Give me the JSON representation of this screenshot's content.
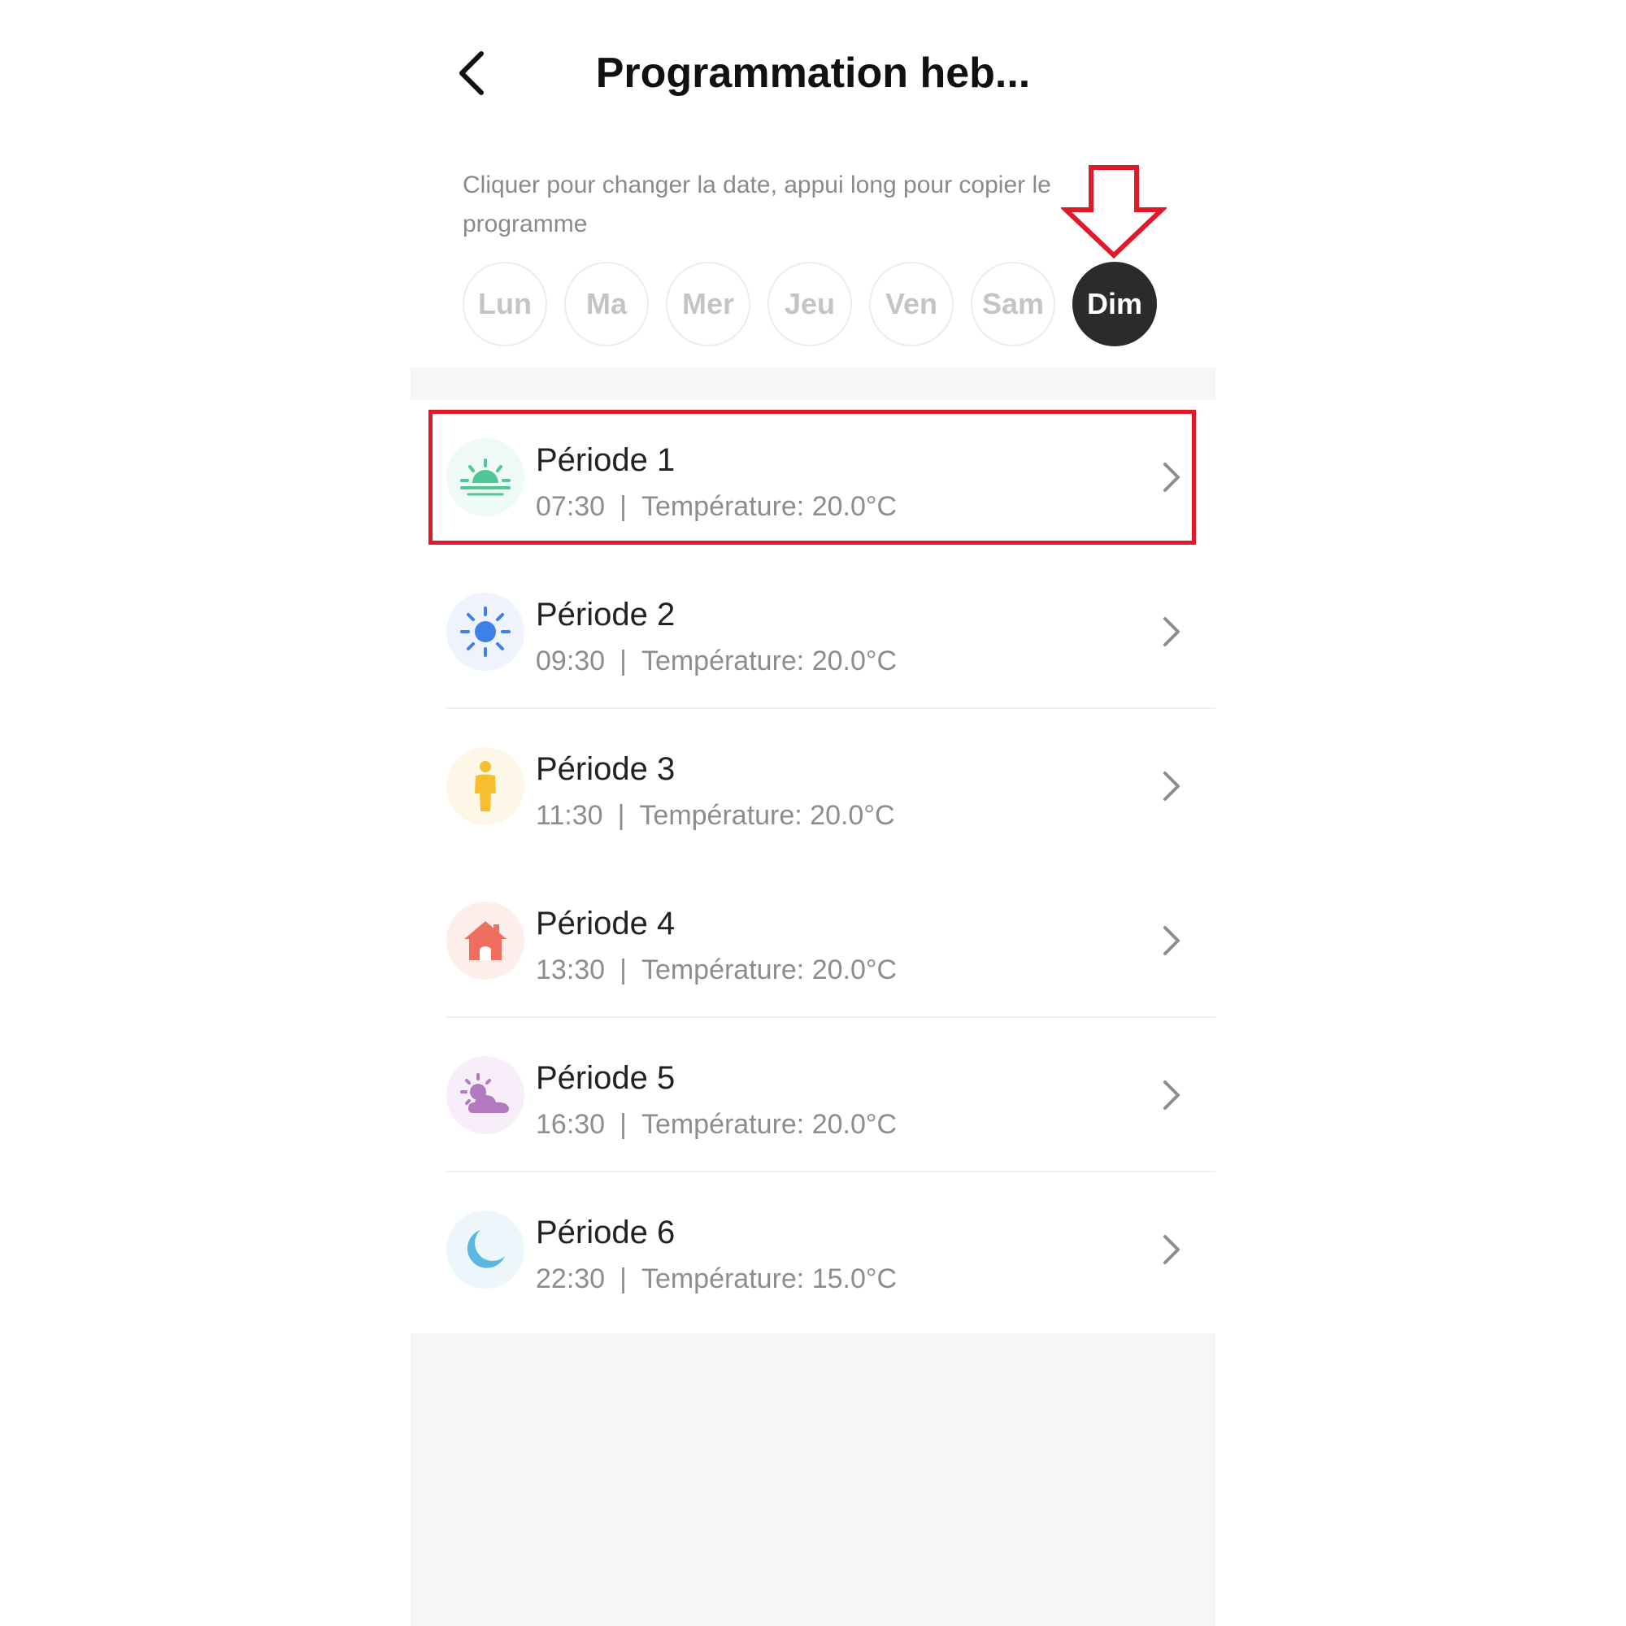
{
  "header": {
    "title": "Programmation heb..."
  },
  "hint": "Cliquer pour changer la date, appui long pour copier le programme",
  "days": [
    {
      "label": "Lun",
      "active": false
    },
    {
      "label": "Ma",
      "active": false
    },
    {
      "label": "Mer",
      "active": false
    },
    {
      "label": "Jeu",
      "active": false
    },
    {
      "label": "Ven",
      "active": false
    },
    {
      "label": "Sam",
      "active": false
    },
    {
      "label": "Dim",
      "active": true
    }
  ],
  "periods": [
    {
      "title": "Période 1",
      "time": "07:30",
      "temperature": "Température: 20.0°C",
      "icon": "sunrise-icon",
      "color": "#4fc59a",
      "bg": "#eefaf4"
    },
    {
      "title": "Période 2",
      "time": "09:30",
      "temperature": "Température: 20.0°C",
      "icon": "sun-icon",
      "color": "#3f7fe8",
      "bg": "#eef3fd"
    },
    {
      "title": "Période 3",
      "time": "11:30",
      "temperature": "Température: 20.0°C",
      "icon": "person-icon",
      "color": "#f5bf2e",
      "bg": "#fdf7e8"
    },
    {
      "title": "Période 4",
      "time": "13:30",
      "temperature": "Température: 20.0°C",
      "icon": "house-icon",
      "color": "#ef6f5e",
      "bg": "#fdeeec"
    },
    {
      "title": "Période 5",
      "time": "16:30",
      "temperature": "Température: 20.0°C",
      "icon": "sun-cloud-icon",
      "color": "#b278c0",
      "bg": "#f8eef9"
    },
    {
      "title": "Période 6",
      "time": "22:30",
      "temperature": "Température: 15.0°C",
      "icon": "moon-icon",
      "color": "#5bb7de",
      "bg": "#ecf6fb"
    }
  ],
  "separator": "|",
  "colors": {
    "annotation": "#e11a2b",
    "active_day": "#2b2b2b"
  }
}
